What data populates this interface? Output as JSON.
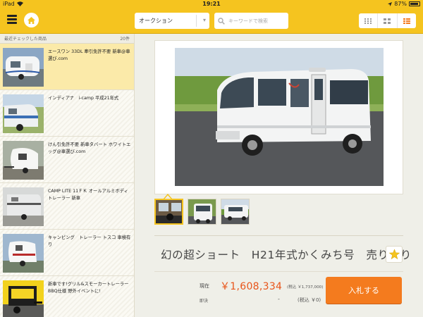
{
  "status_bar": {
    "device": "iPad",
    "time": "19:21",
    "battery": "87%"
  },
  "header": {
    "category_select": "オークション",
    "search_placeholder": "キーワードで検索",
    "view_modes": [
      "list-grid-icon",
      "grid-icon",
      "detail-icon"
    ],
    "accent_color": "#f5c41f"
  },
  "sidebar": {
    "heading": "最近チェックした商品",
    "count": "20件",
    "items": [
      {
        "title": "エースワン 33DL 牽引免許不要 新車@車選び.com",
        "active": true
      },
      {
        "title": "インディアナ　i-camp 平成21年式",
        "active": false
      },
      {
        "title": "けん引免許不要 新車タバート ホワイトエッグ@車選び.com",
        "active": false
      },
      {
        "title": "CAMP LITE 11ＦＫ オールアルミボディトレーラー 新車",
        "active": false
      },
      {
        "title": "キャンピング　トレーラー トスコ 車検有り",
        "active": false
      },
      {
        "title": "新車です!グリル&スモーカートレーラーBBQ仕様 野外イベントに!",
        "active": false
      }
    ]
  },
  "main": {
    "item_name": "幻の超ショート　H21年式かくみち号　売り切り",
    "current_label": "現在",
    "current_price": "￥1,608,334",
    "current_tax": "(税込 ￥1,737,000)",
    "buy_now_label": "即決",
    "buy_now_value": "-",
    "buy_now_tax": "(税込 ￥0)",
    "bid_button": "入札する",
    "price_color": "#e8551a",
    "button_color": "#f47b1e"
  }
}
